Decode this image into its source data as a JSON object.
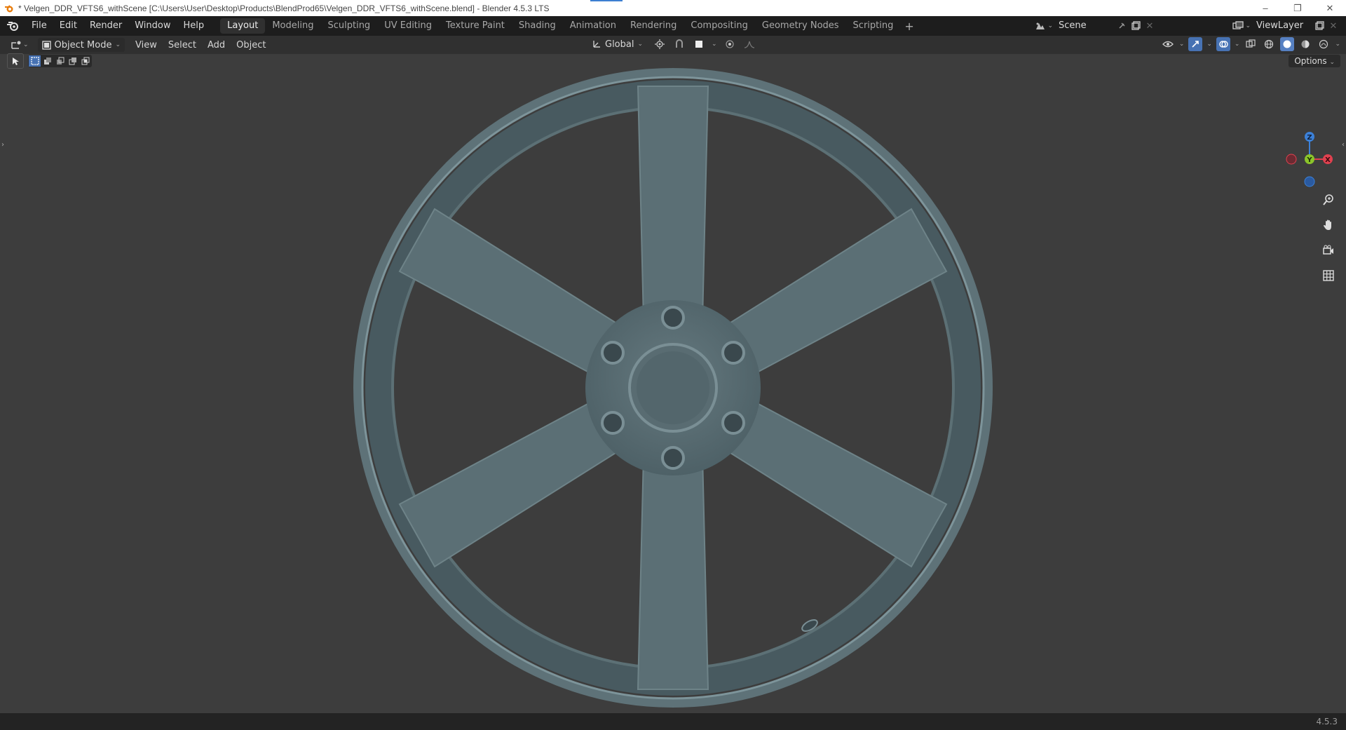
{
  "window": {
    "title": "* Velgen_DDR_VFTS6_withScene [C:\\Users\\User\\Desktop\\Products\\BlendProd65\\Velgen_DDR_VFTS6_withScene.blend] - Blender 4.5.3 LTS",
    "controls": [
      "minimize",
      "restore",
      "close"
    ]
  },
  "menu": {
    "items": [
      "File",
      "Edit",
      "Render",
      "Window",
      "Help"
    ]
  },
  "workspaces": {
    "tabs": [
      "Layout",
      "Modeling",
      "Sculpting",
      "UV Editing",
      "Texture Paint",
      "Shading",
      "Animation",
      "Rendering",
      "Compositing",
      "Geometry Nodes",
      "Scripting"
    ],
    "active": "Layout"
  },
  "scene": {
    "name": "Scene"
  },
  "view_layer": {
    "name": "ViewLayer"
  },
  "viewport_header": {
    "mode": "Object Mode",
    "menus": [
      "View",
      "Select",
      "Add",
      "Object"
    ],
    "orientation": "Global",
    "options_label": "Options"
  },
  "gizmo": {
    "z": "Z",
    "y": "Y",
    "x": "X"
  },
  "status": {
    "version": "4.5.3"
  },
  "colors": {
    "accent": "#4772b3",
    "wheel": "#5b6f75",
    "axis_x": "#e0414f",
    "axis_y": "#8bc42a",
    "axis_z": "#3c81d8"
  }
}
